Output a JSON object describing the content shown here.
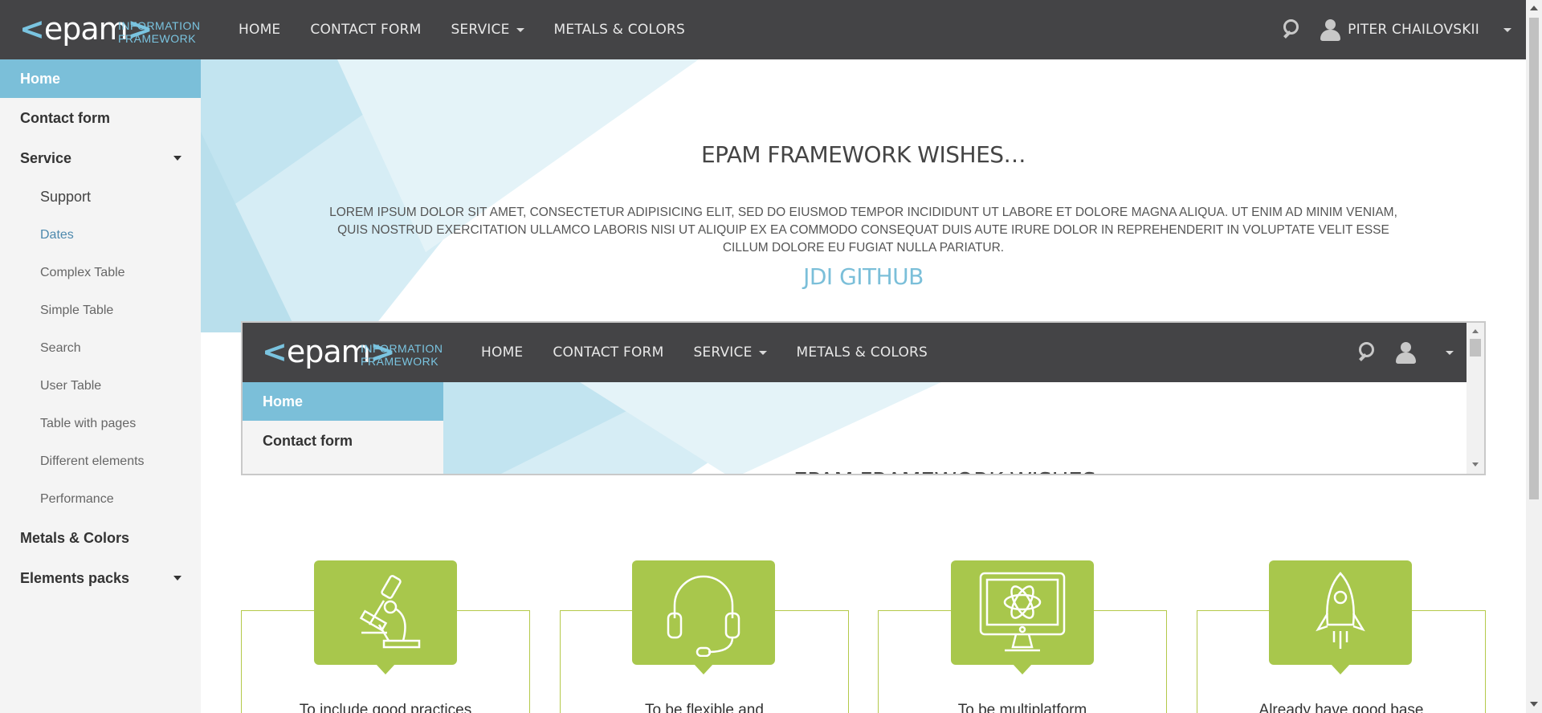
{
  "header": {
    "logo_word": "epam",
    "logo_sub_line1": "INFORMATION",
    "logo_sub_line2": "FRAMEWORK",
    "nav": [
      {
        "label": "HOME"
      },
      {
        "label": "CONTACT FORM"
      },
      {
        "label": "SERVICE"
      },
      {
        "label": "METALS & COLORS"
      }
    ],
    "user_name": "PITER CHAILOVSKII"
  },
  "sidebar": {
    "items": [
      {
        "label": "Home"
      },
      {
        "label": "Contact form"
      },
      {
        "label": "Service"
      },
      {
        "label": "Metals & Colors"
      },
      {
        "label": "Elements packs"
      }
    ],
    "service_sub": [
      {
        "label": "Support"
      },
      {
        "label": "Dates"
      },
      {
        "label": "Complex Table"
      },
      {
        "label": "Simple Table"
      },
      {
        "label": "Search"
      },
      {
        "label": "User Table"
      },
      {
        "label": "Table with pages"
      },
      {
        "label": "Different elements"
      },
      {
        "label": "Performance"
      }
    ]
  },
  "main": {
    "title": "EPAM FRAMEWORK WISHES…",
    "lorem": "LOREM IPSUM DOLOR SIT AMET, CONSECTETUR ADIPISICING ELIT, SED DO EIUSMOD TEMPOR INCIDIDUNT UT LABORE ET DOLORE MAGNA ALIQUA. UT ENIM AD MINIM VENIAM, QUIS NOSTRUD EXERCITATION ULLAMCO LABORIS NISI UT ALIQUIP EX EA COMMODO CONSEQUAT DUIS AUTE IRURE DOLOR IN REPREHENDERIT IN VOLUPTATE VELIT ESSE CILLUM DOLORE EU FUGIAT NULLA PARIATUR.",
    "github_link": "JDI GITHUB"
  },
  "frame": {
    "sidebar": [
      {
        "label": "Home"
      },
      {
        "label": "Contact form"
      }
    ],
    "title_cut": "EPAM FRAMEWORK WISHES…"
  },
  "benefits": [
    {
      "icon": "microscope-icon",
      "text": "To include good practices"
    },
    {
      "icon": "headset-icon",
      "text": "To be flexible and"
    },
    {
      "icon": "monitor-icon",
      "text": "To be multiplatform"
    },
    {
      "icon": "rocket-icon",
      "text": "Already have good base"
    }
  ],
  "colors": {
    "header_bg": "#444446",
    "accent": "#7bbfd9",
    "benefit_green": "#a8c74c"
  }
}
